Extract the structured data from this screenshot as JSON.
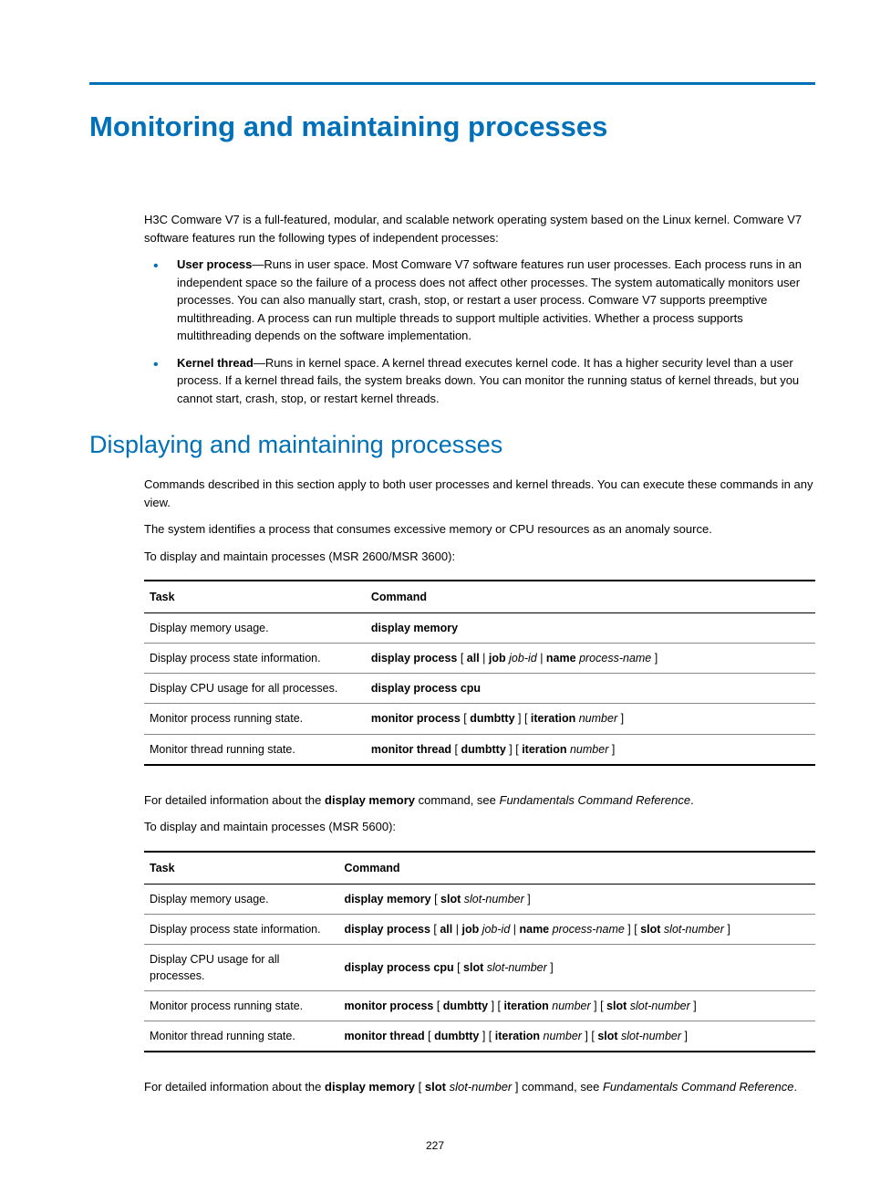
{
  "heading1": "Monitoring and maintaining processes",
  "intro": "H3C Comware V7 is a full-featured, modular, and scalable network operating system based on the Linux kernel. Comware V7 software features run the following types of independent processes:",
  "bullets": [
    {
      "label": "User process",
      "text": "—Runs in user space. Most Comware V7 software features run user processes. Each process runs in an independent space so the failure of a process does not affect other processes. The system automatically monitors user processes. You can also manually start, crash, stop, or restart a user process. Comware V7 supports preemptive multithreading. A process can run multiple threads to support multiple activities. Whether a process supports multithreading depends on the software implementation."
    },
    {
      "label": "Kernel thread",
      "text": "—Runs in kernel space. A kernel thread executes kernel code. It has a higher security level than a user process. If a kernel thread fails, the system breaks down. You can monitor the running status of kernel threads, but you cannot start, crash, stop, or restart kernel threads."
    }
  ],
  "heading2": "Displaying and maintaining processes",
  "para1": "Commands described in this section apply to both user processes and kernel threads. You can execute these commands in any view.",
  "para2": "The system identifies a process that consumes excessive memory or CPU resources as an anomaly source.",
  "para3": "To display and maintain processes (MSR 2600/MSR 3600):",
  "table_headers": {
    "task": "Task",
    "command": "Command"
  },
  "table1": [
    {
      "task": "Display memory usage.",
      "cmd": [
        "b:display memory"
      ]
    },
    {
      "task": "Display process state information.",
      "cmd": [
        "b:display process",
        " [ ",
        "b:all",
        " | ",
        "b:job",
        " ",
        "i:job-id",
        " | ",
        "b:name",
        " ",
        "i:process-name",
        " ]"
      ]
    },
    {
      "task": "Display CPU usage for all processes.",
      "cmd": [
        "b:display process cpu"
      ]
    },
    {
      "task": "Monitor process running state.",
      "cmd": [
        "b:monitor process",
        " [ ",
        "b:dumbtty",
        " ] [ ",
        "b:iteration",
        " ",
        "i:number",
        " ]"
      ]
    },
    {
      "task": "Monitor thread running state.",
      "cmd": [
        "b:monitor thread",
        " [ ",
        "b:dumbtty",
        " ] [ ",
        "b:iteration",
        " ",
        "i:number",
        " ]"
      ]
    }
  ],
  "after1": [
    "For detailed information about the ",
    "b:display memory",
    " command, see ",
    "i:Fundamentals Command Reference",
    "."
  ],
  "para4": "To display and maintain processes (MSR 5600):",
  "table2": [
    {
      "task": "Display memory usage.",
      "cmd": [
        "b:display memory",
        " [ ",
        "b:slot",
        " ",
        "i:slot-number",
        " ]"
      ]
    },
    {
      "task": "Display process state information.",
      "cmd": [
        "b:display process",
        " [ ",
        "b:all",
        " | ",
        "b:job",
        " ",
        "i:job-id",
        " | ",
        "b:name",
        " ",
        "i:process-name",
        " ] [ ",
        "b:slot",
        " ",
        "i:slot-number",
        " ]"
      ]
    },
    {
      "task": "Display CPU usage for all processes.",
      "cmd": [
        "b:display process cpu",
        " [ ",
        "b:slot",
        " ",
        "i:slot-number",
        " ]"
      ]
    },
    {
      "task": "Monitor process running state.",
      "cmd": [
        "b:monitor process",
        " [ ",
        "b:dumbtty",
        " ] [ ",
        "b:iteration",
        " ",
        "i:number",
        " ] [ ",
        "b:slot",
        " ",
        "i:slot-number",
        " ]"
      ]
    },
    {
      "task": "Monitor thread running state.",
      "cmd": [
        "b:monitor thread",
        " [ ",
        "b:dumbtty",
        " ] [ ",
        "b:iteration",
        " ",
        "i:number",
        " ] [ ",
        "b:slot",
        " ",
        "i:slot-number",
        " ]"
      ]
    }
  ],
  "after2": [
    "For detailed information about the ",
    "b:display memory",
    " [ ",
    "b:slot",
    " ",
    "i:slot-number",
    " ] command, see ",
    "i:Fundamentals Command Reference",
    "."
  ],
  "page_number": "227"
}
